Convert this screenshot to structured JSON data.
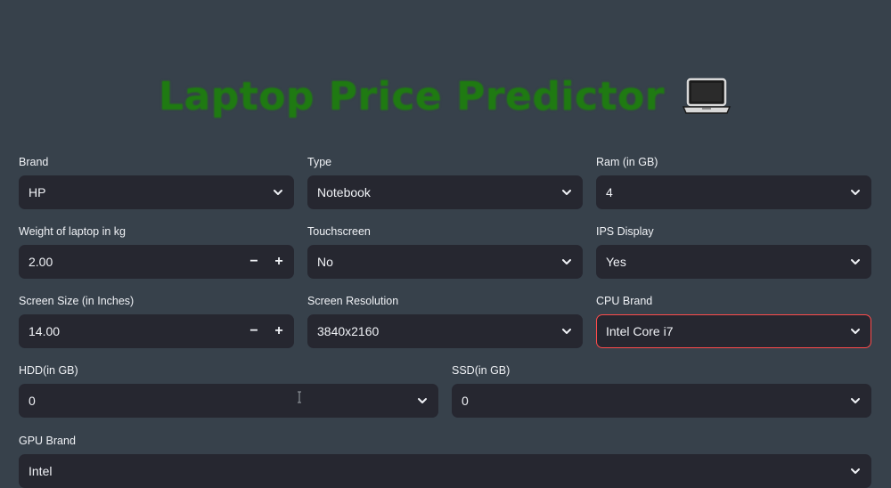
{
  "header": {
    "title": "Laptop Price Predictor",
    "icon": "laptop-icon",
    "title_color": "#1f7a12"
  },
  "form": {
    "brand": {
      "label": "Brand",
      "value": "HP"
    },
    "type": {
      "label": "Type",
      "value": "Notebook"
    },
    "ram": {
      "label": "Ram (in GB)",
      "value": "4"
    },
    "weight": {
      "label": "Weight of laptop in kg",
      "value": "2.00",
      "minus": "−",
      "plus": "+"
    },
    "touchscreen": {
      "label": "Touchscreen",
      "value": "No"
    },
    "ips": {
      "label": "IPS Display",
      "value": "Yes"
    },
    "screen_size": {
      "label": "Screen Size (in Inches)",
      "value": "14.00",
      "minus": "−",
      "plus": "+"
    },
    "resolution": {
      "label": "Screen Resolution",
      "value": "3840x2160"
    },
    "cpu": {
      "label": "CPU Brand",
      "value": "Intel Core i7"
    },
    "hdd": {
      "label": "HDD(in GB)",
      "value": "0"
    },
    "ssd": {
      "label": "SSD(in GB)",
      "value": "0"
    },
    "gpu": {
      "label": "GPU Brand",
      "value": "Intel"
    }
  },
  "colors": {
    "background": "#37414b",
    "control_bg": "#262730",
    "focus_border": "#ff4b4b",
    "text": "#f0f2f6"
  }
}
